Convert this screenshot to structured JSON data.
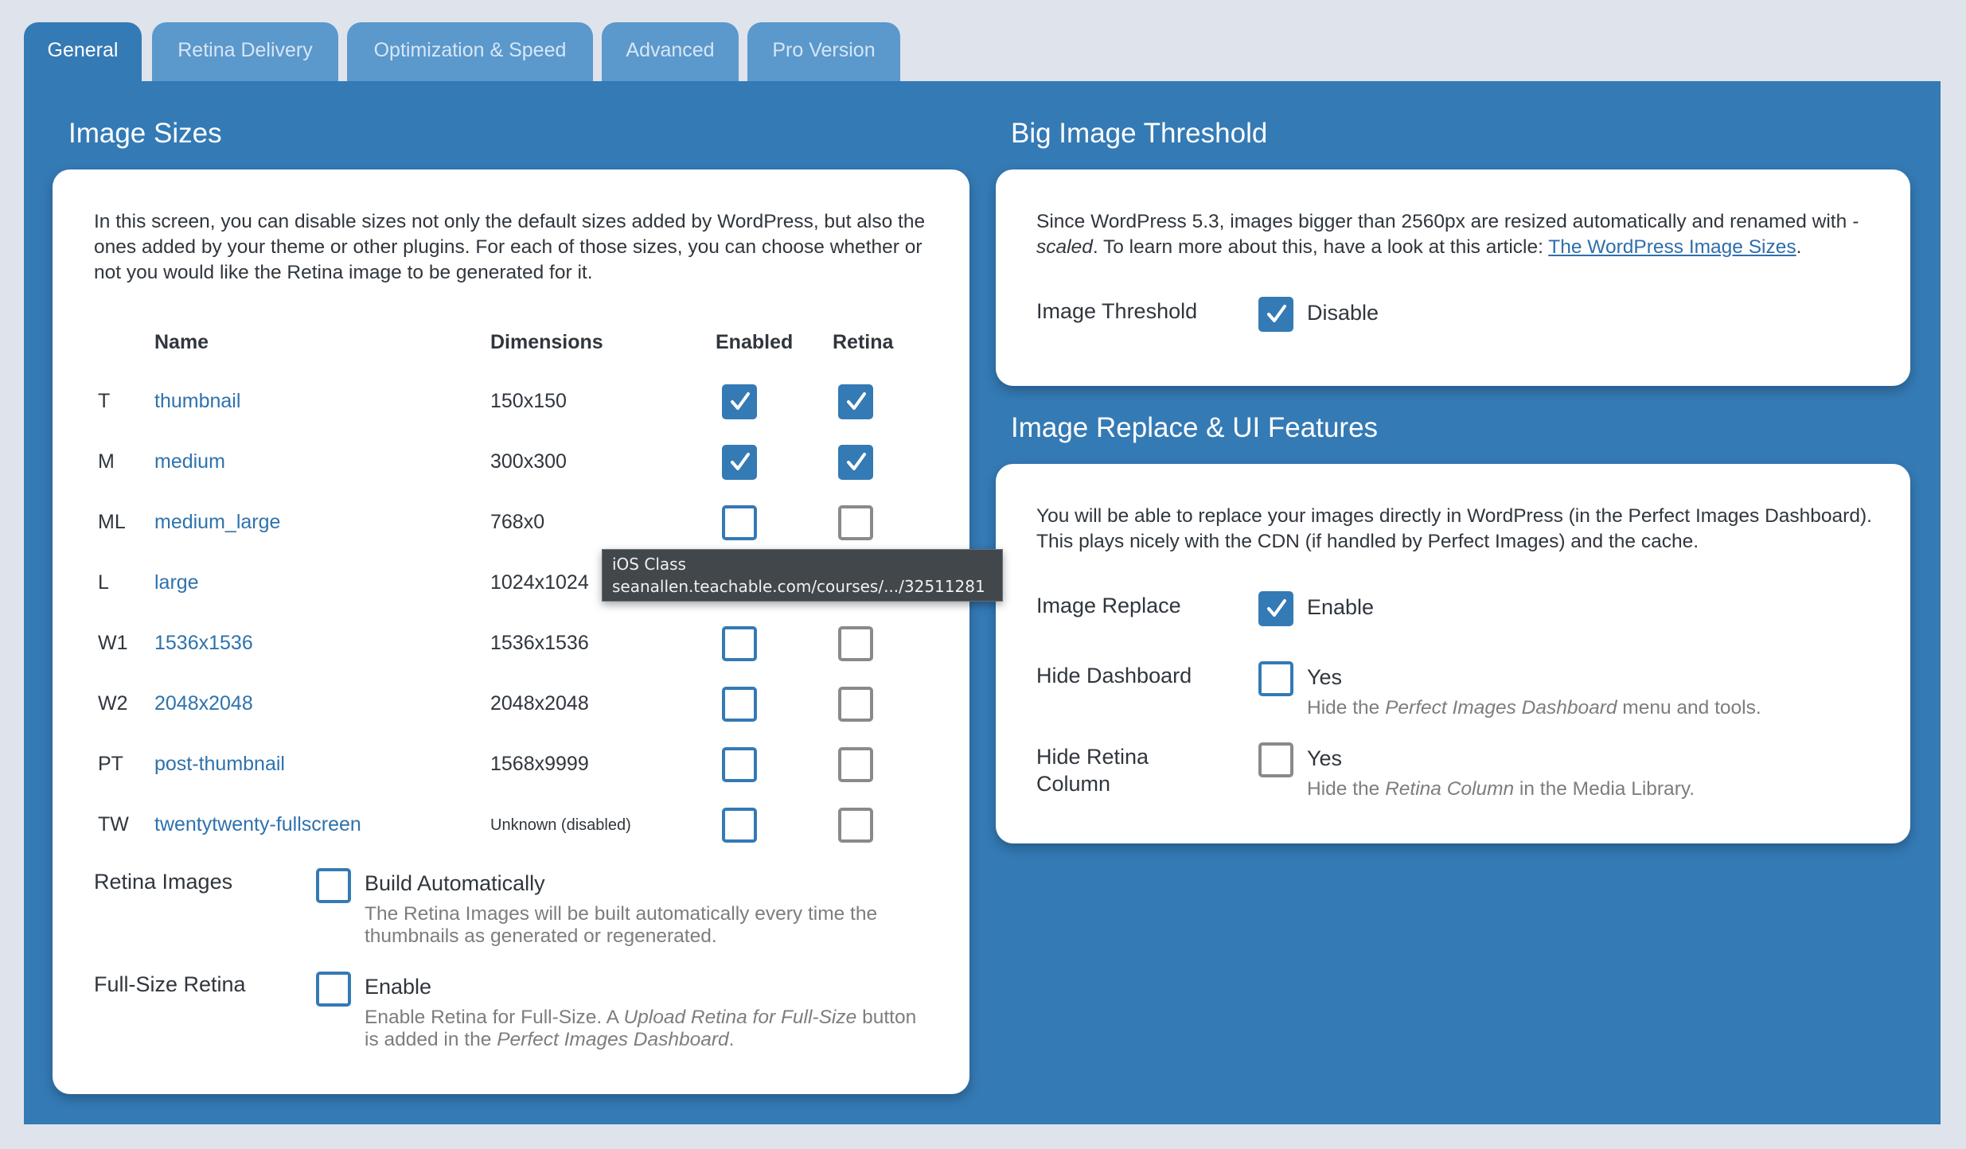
{
  "tabs": [
    {
      "label": "General",
      "active": true
    },
    {
      "label": "Retina Delivery",
      "active": false
    },
    {
      "label": "Optimization & Speed",
      "active": false
    },
    {
      "label": "Advanced",
      "active": false
    },
    {
      "label": "Pro Version",
      "active": false
    }
  ],
  "image_sizes": {
    "title": "Image Sizes",
    "description": "In this screen, you can disable sizes not only the default sizes added by WordPress, but also the ones added by your theme or other plugins. For each of those sizes, you can choose whether or not you would like the Retina image to be generated for it.",
    "columns": {
      "name": "Name",
      "dimensions": "Dimensions",
      "enabled": "Enabled",
      "retina": "Retina"
    },
    "rows": [
      {
        "code": "T",
        "name": "thumbnail",
        "dimensions": "150x150",
        "enabled": true,
        "retina": true
      },
      {
        "code": "M",
        "name": "medium",
        "dimensions": "300x300",
        "enabled": true,
        "retina": true
      },
      {
        "code": "ML",
        "name": "medium_large",
        "dimensions": "768x0",
        "enabled": false,
        "retina": false
      },
      {
        "code": "L",
        "name": "large",
        "dimensions": "1024x1024",
        "enabled": false,
        "retina": false
      },
      {
        "code": "W1",
        "name": "1536x1536",
        "dimensions": "1536x1536",
        "enabled": false,
        "retina": false
      },
      {
        "code": "W2",
        "name": "2048x2048",
        "dimensions": "2048x2048",
        "enabled": false,
        "retina": false
      },
      {
        "code": "PT",
        "name": "post-thumbnail",
        "dimensions": "1568x9999",
        "enabled": false,
        "retina": false
      },
      {
        "code": "TW",
        "name": "twentytwenty-fullscreen",
        "dimensions": "Unknown (disabled)",
        "enabled": false,
        "retina": false
      }
    ],
    "retina_images": {
      "label": "Retina Images",
      "option": "Build Automatically",
      "checked": false,
      "help": "The Retina Images will be built automatically every time the thumbnails as generated or regenerated."
    },
    "full_size_retina": {
      "label": "Full-Size Retina",
      "option": "Enable",
      "checked": false,
      "help_prefix": "Enable Retina for Full-Size. A ",
      "help_em1": "Upload Retina for Full-Size",
      "help_mid": " button is added in the ",
      "help_em2": "Perfect Images Dashboard",
      "help_suffix": "."
    }
  },
  "big_image": {
    "title": "Big Image Threshold",
    "desc_prefix": "Since WordPress 5.3, images bigger than 2560px are resized automatically and renamed with ",
    "desc_em": "-scaled",
    "desc_mid": ". To learn more about this, have a look at this article: ",
    "desc_link": "The WordPress Image Sizes",
    "desc_suffix": ".",
    "threshold": {
      "label": "Image Threshold",
      "option": "Disable",
      "checked": true
    }
  },
  "image_replace": {
    "title": "Image Replace & UI Features",
    "description": "You will be able to replace your images directly in WordPress (in the Perfect Images Dashboard). This plays nicely with the CDN (if handled by Perfect Images) and the cache.",
    "replace": {
      "label": "Image Replace",
      "option": "Enable",
      "checked": true
    },
    "hide_dashboard": {
      "label": "Hide Dashboard",
      "option": "Yes",
      "checked": false,
      "help_prefix": "Hide the ",
      "help_em": "Perfect Images Dashboard",
      "help_suffix": " menu and tools."
    },
    "hide_retina_column": {
      "label_line1": "Hide Retina",
      "label_line2": "Column",
      "option": "Yes",
      "checked": false,
      "help_prefix": "Hide the ",
      "help_em": "Retina Column",
      "help_suffix": " in the Media Library."
    }
  },
  "tooltip": {
    "line1": "iOS Class",
    "line2": "seanallen.teachable.com/courses/.../32511281"
  },
  "colors": {
    "accent": "#347ab5",
    "inactive_tab": "#5b98cc",
    "page_bg": "#dfe3eb",
    "link": "#2e72ad",
    "help_text": "#7d7d7d"
  }
}
